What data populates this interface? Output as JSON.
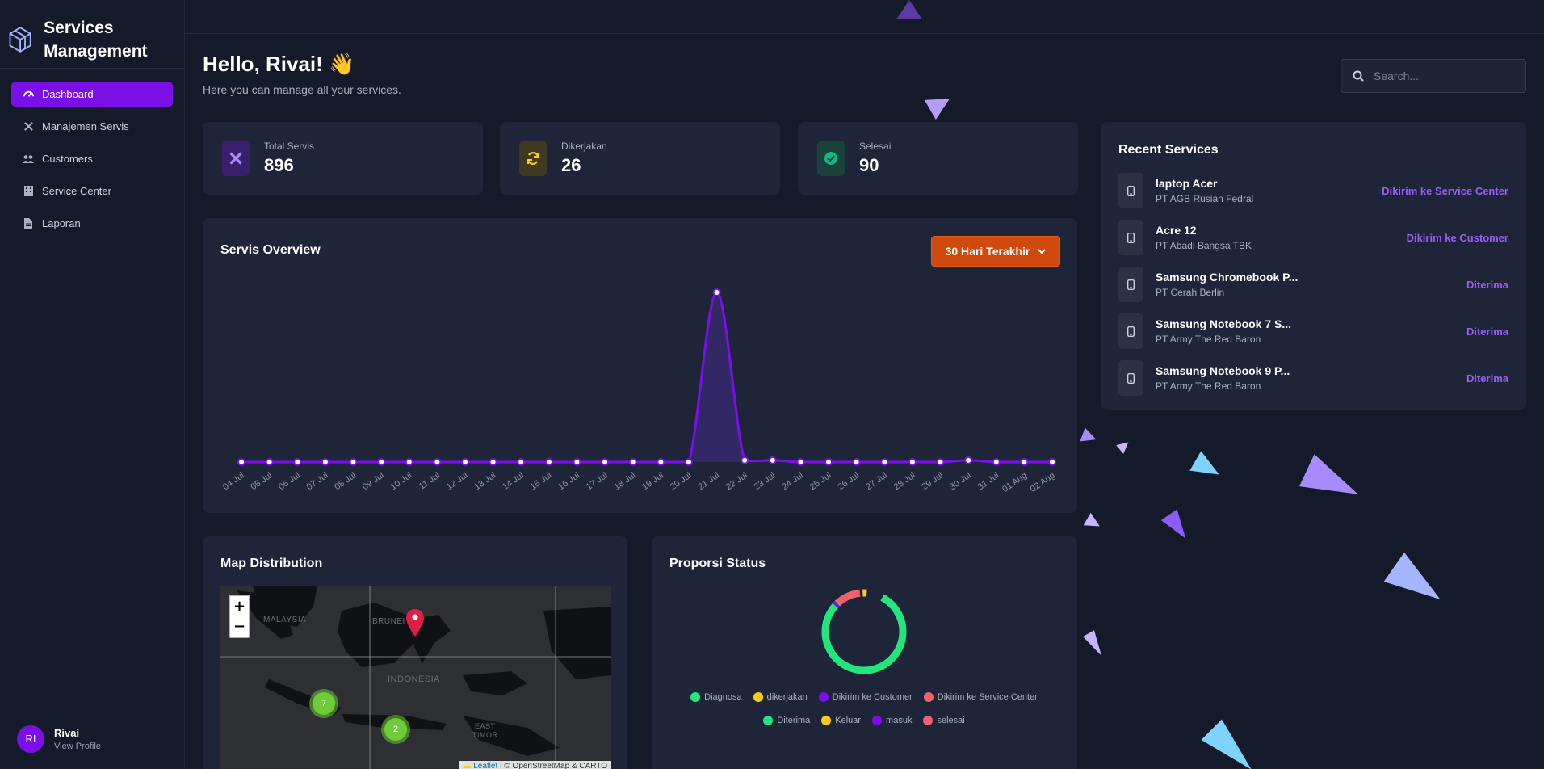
{
  "sidebar": {
    "brand": "Services Management",
    "items": [
      {
        "label": "Dashboard",
        "active": true
      },
      {
        "label": "Manajemen Servis"
      },
      {
        "label": "Customers"
      },
      {
        "label": "Service Center"
      },
      {
        "label": "Laporan"
      }
    ],
    "profile": {
      "initials": "RI",
      "name": "Rivai",
      "link": "View Profile"
    }
  },
  "header": {
    "greeting": "Hello, Rivai! 👋",
    "subtitle": "Here you can manage all your services.",
    "search_placeholder": "Search..."
  },
  "stats": [
    {
      "label": "Total Servis",
      "value": "896",
      "icon": "tools-icon",
      "color": "#7b0fe8"
    },
    {
      "label": "Dikerjakan",
      "value": "26",
      "icon": "refresh-icon",
      "color": "#facc15"
    },
    {
      "label": "Selesai",
      "value": "90",
      "icon": "check-circle-icon",
      "color": "#10b981"
    }
  ],
  "overview": {
    "title": "Servis Overview",
    "range_button": "30 Hari Terakhir"
  },
  "chart_data": {
    "type": "area",
    "x": [
      "04 Jul",
      "05 Jul",
      "06 Jul",
      "07 Jul",
      "08 Jul",
      "09 Jul",
      "10 Jul",
      "11 Jul",
      "12 Jul",
      "13 Jul",
      "14 Jul",
      "15 Jul",
      "16 Jul",
      "17 Jul",
      "18 Jul",
      "19 Jul",
      "20 Jul",
      "21 Jul",
      "22 Jul",
      "23 Jul",
      "24 Jul",
      "25 Jul",
      "26 Jul",
      "27 Jul",
      "28 Jul",
      "29 Jul",
      "30 Jul",
      "31 Jul",
      "01 Aug",
      "02 Aug"
    ],
    "values": [
      0,
      0,
      0,
      0,
      0,
      0,
      0,
      0,
      0,
      0,
      0,
      0,
      0,
      0,
      0,
      0,
      0,
      100,
      1,
      1,
      0,
      0,
      0,
      0,
      0,
      0,
      1,
      0,
      0,
      0
    ],
    "color": "#7b0fe8"
  },
  "recent": {
    "title": "Recent Services",
    "items": [
      {
        "name": "laptop Acer",
        "company": "PT AGB Rusian Fedral",
        "status": "Dikirim ke Service Center"
      },
      {
        "name": "Acre 12",
        "company": "PT Abadi Bangsa TBK",
        "status": "Dikirim ke Customer"
      },
      {
        "name": "Samsung Chromebook P...",
        "company": "PT Cerah Berlin",
        "status": "Diterima"
      },
      {
        "name": "Samsung Notebook 7 S...",
        "company": "PT Army The Red Baron",
        "status": "Diterima"
      },
      {
        "name": "Samsung Notebook 9 P...",
        "company": "PT Army The Red Baron",
        "status": "Diterima"
      }
    ]
  },
  "map": {
    "title": "Map Distribution",
    "zoom_in": "+",
    "zoom_out": "−",
    "labels": {
      "malaysia": "MALAYSIA",
      "brunei": "BRUNEI",
      "indonesia": "INDONESIA",
      "east_timor_1": "EAST",
      "east_timor_2": "TIMOR"
    },
    "clusters": [
      {
        "count": "7"
      },
      {
        "count": "2"
      }
    ],
    "attribution_link": "Leaflet",
    "attribution_text": " | © OpenStreetMap & CARTO"
  },
  "status_chart": {
    "title": "Proporsi Status",
    "legend": [
      {
        "label": "Diagnosa",
        "color": "#22e57c"
      },
      {
        "label": "dikerjakan",
        "color": "#facc15"
      },
      {
        "label": "Dikirim ke Customer",
        "color": "#7b0fe8"
      },
      {
        "label": "Dikirim ke Service Center",
        "color": "#f0606b"
      },
      {
        "label": "Diterima",
        "color": "#22e57c"
      },
      {
        "label": "Keluar",
        "color": "#facc15"
      },
      {
        "label": "masuk",
        "color": "#7b0fe8"
      },
      {
        "label": "selesai",
        "color": "#f0606b"
      }
    ]
  }
}
